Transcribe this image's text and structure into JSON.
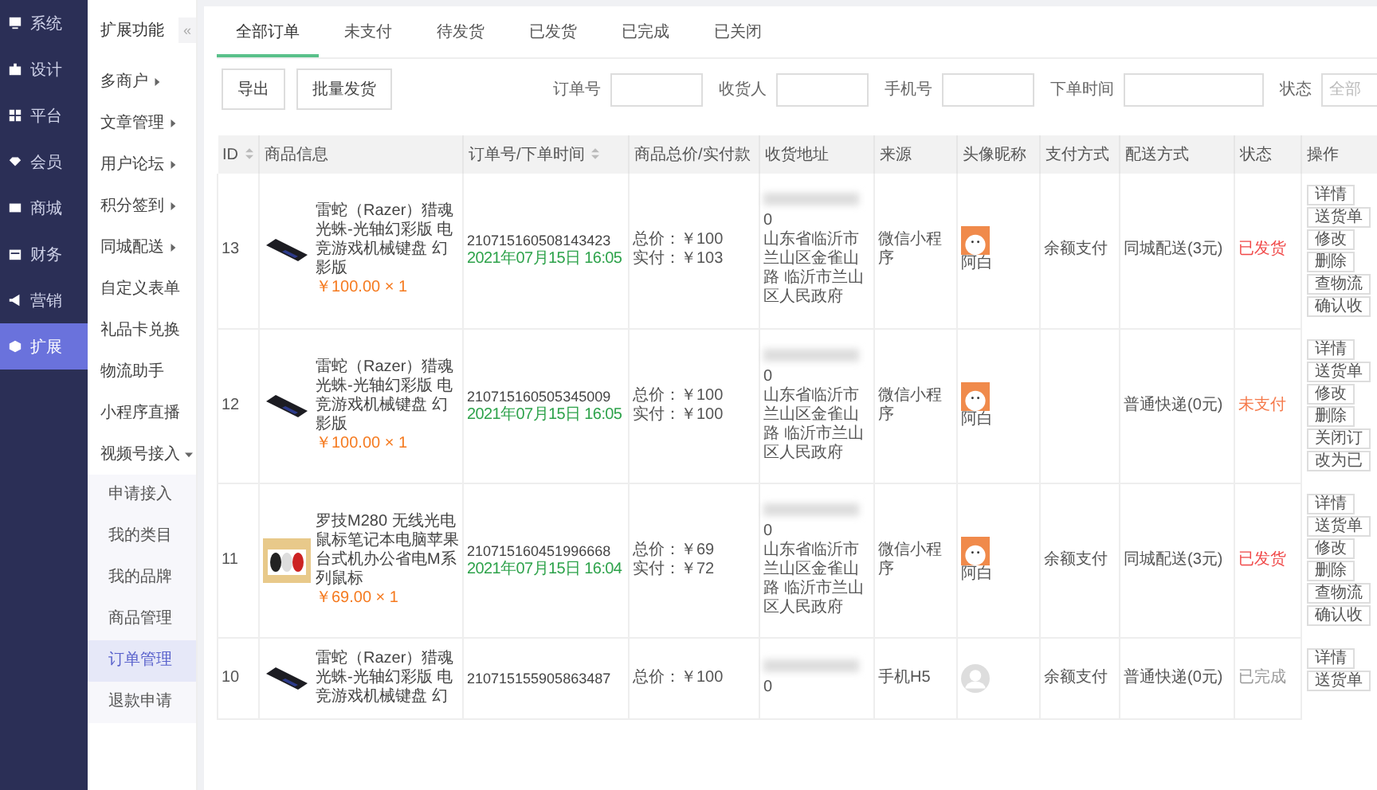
{
  "main_nav": [
    {
      "label": "系统",
      "selected": false
    },
    {
      "label": "设计",
      "selected": false
    },
    {
      "label": "平台",
      "selected": false
    },
    {
      "label": "会员",
      "selected": false
    },
    {
      "label": "商城",
      "selected": false
    },
    {
      "label": "财务",
      "selected": false
    },
    {
      "label": "营销",
      "selected": false
    },
    {
      "label": "扩展",
      "selected": true
    }
  ],
  "sub_nav": {
    "title": "扩展功能",
    "collapse": "«",
    "items": [
      {
        "label": "多商户",
        "kind": "group",
        "expanded": false
      },
      {
        "label": "文章管理",
        "kind": "group",
        "expanded": false
      },
      {
        "label": "用户论坛",
        "kind": "group",
        "expanded": false
      },
      {
        "label": "积分签到",
        "kind": "group",
        "expanded": false
      },
      {
        "label": "同城配送",
        "kind": "group",
        "expanded": false
      },
      {
        "label": "自定义表单",
        "kind": "link",
        "selected": false
      },
      {
        "label": "礼品卡兑换",
        "kind": "link",
        "selected": false
      },
      {
        "label": "物流助手",
        "kind": "link",
        "selected": false
      },
      {
        "label": "小程序直播",
        "kind": "link",
        "selected": false
      },
      {
        "label": "视频号接入",
        "kind": "group",
        "expanded": true,
        "children": [
          {
            "label": "申请接入",
            "selected": false
          },
          {
            "label": "我的类目",
            "selected": false
          },
          {
            "label": "我的品牌",
            "selected": false
          },
          {
            "label": "商品管理",
            "selected": false
          },
          {
            "label": "订单管理",
            "selected": true
          },
          {
            "label": "退款申请",
            "selected": false
          }
        ]
      }
    ]
  },
  "tabs": [
    {
      "label": "全部订单",
      "selected": true
    },
    {
      "label": "未支付",
      "selected": false
    },
    {
      "label": "待发货",
      "selected": false
    },
    {
      "label": "已发货",
      "selected": false
    },
    {
      "label": "已完成",
      "selected": false
    },
    {
      "label": "已关闭",
      "selected": false
    }
  ],
  "toolbar": {
    "buttons": [
      "导出",
      "批量发货"
    ],
    "filters": [
      {
        "label": "订单号",
        "kind": "text"
      },
      {
        "label": "收货人",
        "kind": "text"
      },
      {
        "label": "手机号",
        "kind": "text"
      },
      {
        "label": "下单时间",
        "kind": "date"
      },
      {
        "label": "状态",
        "kind": "select",
        "placeholder": "全部"
      }
    ]
  },
  "table": {
    "columns": [
      {
        "label": "ID",
        "sortable": true
      },
      {
        "label": "商品信息",
        "sortable": false
      },
      {
        "label": "订单号/下单时间",
        "sortable": true
      },
      {
        "label": "商品总价/实付款",
        "sortable": false
      },
      {
        "label": "收货地址",
        "sortable": false
      },
      {
        "label": "来源",
        "sortable": false
      },
      {
        "label": "头像昵称",
        "sortable": false
      },
      {
        "label": "支付方式",
        "sortable": false
      },
      {
        "label": "配送方式",
        "sortable": false
      },
      {
        "label": "状态",
        "sortable": false
      },
      {
        "label": "操作",
        "sortable": false
      }
    ],
    "rows": [
      {
        "id": "13",
        "product": {
          "name": "雷蛇（Razer）猎魂光蛛-光轴幻彩版 电竞游戏机械键盘 幻影版",
          "price": "￥100.00 × 1"
        },
        "order_no": "210715160508143423",
        "time": "2021年07月15日 16:05",
        "total": "总价：￥100",
        "paid": "实付：￥103",
        "address_zip": "0",
        "address": "山东省临沂市兰山区金雀山路 临沂市兰山区人民政府",
        "source": "微信小程序",
        "nickname": "阿白",
        "payment": "余额支付",
        "delivery": "同城配送(3元)",
        "status": {
          "text": "已发货",
          "color": "#f04848"
        },
        "actions": [
          "详情",
          "送货单",
          "修改",
          "删除",
          "查物流",
          "确认收"
        ]
      },
      {
        "id": "12",
        "product": {
          "name": "雷蛇（Razer）猎魂光蛛-光轴幻彩版 电竞游戏机械键盘 幻影版",
          "price": "￥100.00 × 1"
        },
        "order_no": "210715160505345009",
        "time": "2021年07月15日 16:05",
        "total": "总价：￥100",
        "paid": "实付：￥100",
        "address_zip": "0",
        "address": "山东省临沂市兰山区金雀山路 临沂市兰山区人民政府",
        "source": "微信小程序",
        "nickname": "阿白",
        "delivery": "普通快递(0元)",
        "status": {
          "text": "未支付",
          "color": "#f5794a"
        },
        "actions": [
          "详情",
          "送货单",
          "修改",
          "删除",
          "关闭订",
          "改为已"
        ]
      },
      {
        "id": "11",
        "product": {
          "name": "罗技M280 无线光电鼠标笔记本电脑苹果台式机办公省电M系列鼠标",
          "price": "￥69.00 × 1"
        },
        "order_no": "210715160451996668",
        "time": "2021年07月15日 16:04",
        "total": "总价：￥69",
        "paid": "实付：￥72",
        "address_zip": "0",
        "address": "山东省临沂市兰山区金雀山路 临沂市兰山区人民政府",
        "source": "微信小程序",
        "nickname": "阿白",
        "payment": "余额支付",
        "delivery": "同城配送(3元)",
        "status": {
          "text": "已发货",
          "color": "#f04848"
        },
        "actions": [
          "详情",
          "送货单",
          "修改",
          "删除",
          "查物流",
          "确认收"
        ]
      },
      {
        "id": "10",
        "product": {
          "name": "雷蛇（Razer）猎魂光蛛-光轴幻彩版 电竞游戏机械键盘 幻"
        },
        "order_no": "210715155905863487",
        "total": "总价：￥100",
        "address_zip": "0",
        "source": "手机H5",
        "payment": "余额支付",
        "delivery": "普通快递(0元)",
        "status": {
          "text": "已完成",
          "color": "#999999"
        },
        "actions": [
          "详情",
          "送货单"
        ]
      }
    ]
  }
}
